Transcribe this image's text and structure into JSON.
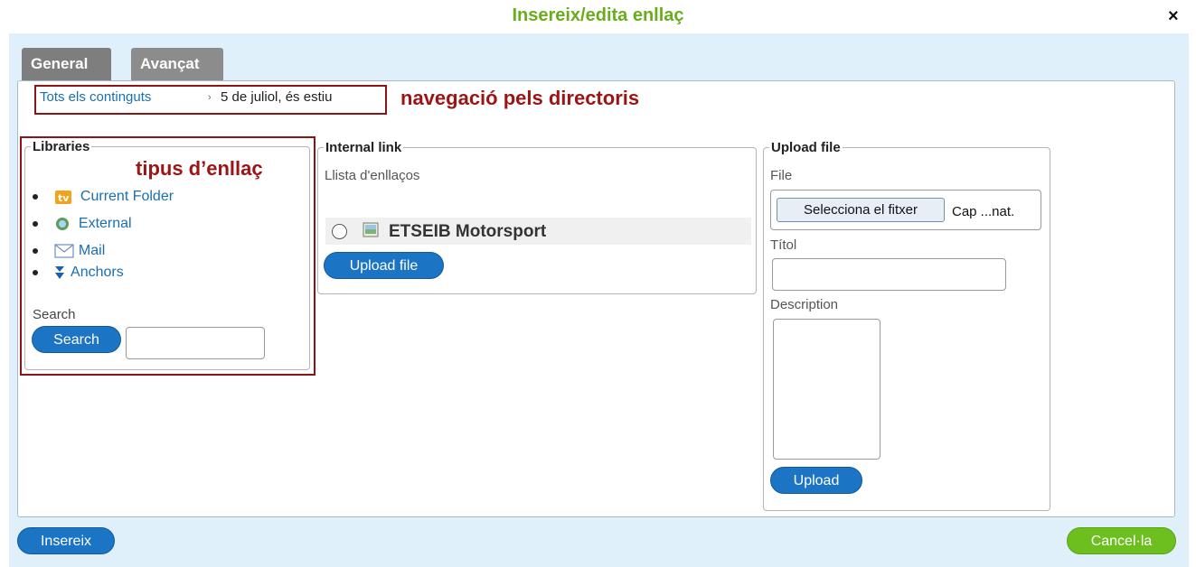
{
  "dialog": {
    "title": "Insereix/edita enllaç",
    "close_label": "×"
  },
  "tabs": [
    {
      "label": "General"
    },
    {
      "label": "Avançat"
    }
  ],
  "breadcrumb": {
    "root": "Tots els continguts",
    "separator": "›",
    "current": "5 de juliol, és estiu"
  },
  "annotations": {
    "nav": "navegació pels directoris",
    "link_type": "tipus d’enllaç"
  },
  "libraries": {
    "legend": "Libraries",
    "items": [
      {
        "label": "Current Folder",
        "icon": "folder-icon"
      },
      {
        "label": "External",
        "icon": "globe-icon"
      },
      {
        "label": "Mail",
        "icon": "mail-icon"
      },
      {
        "label": "Anchors",
        "icon": "anchor-arrow-icon"
      }
    ],
    "search_label": "Search",
    "search_button": "Search",
    "search_value": ""
  },
  "internal_link": {
    "legend": "Internal link",
    "list_label": "Llista d'enllaços",
    "items": [
      {
        "label": "ETSEIB Motorsport",
        "icon": "image-icon"
      }
    ],
    "upload_button": "Upload file"
  },
  "upload": {
    "legend": "Upload file",
    "file_label": "File",
    "file_button": "Selecciona el fitxer",
    "file_name": "Cap ...nat.",
    "title_label": "Títol",
    "title_value": "",
    "description_label": "Description",
    "description_value": "",
    "upload_button": "Upload"
  },
  "footer": {
    "insert_button": "Insereix",
    "cancel_button": "Cancel·la"
  },
  "colors": {
    "title_green": "#6aad1c",
    "primary_blue": "#1b74c4",
    "cancel_green": "#6cbf1f",
    "annotation_red": "#9c1414",
    "dialog_bg": "#dff0fb"
  }
}
